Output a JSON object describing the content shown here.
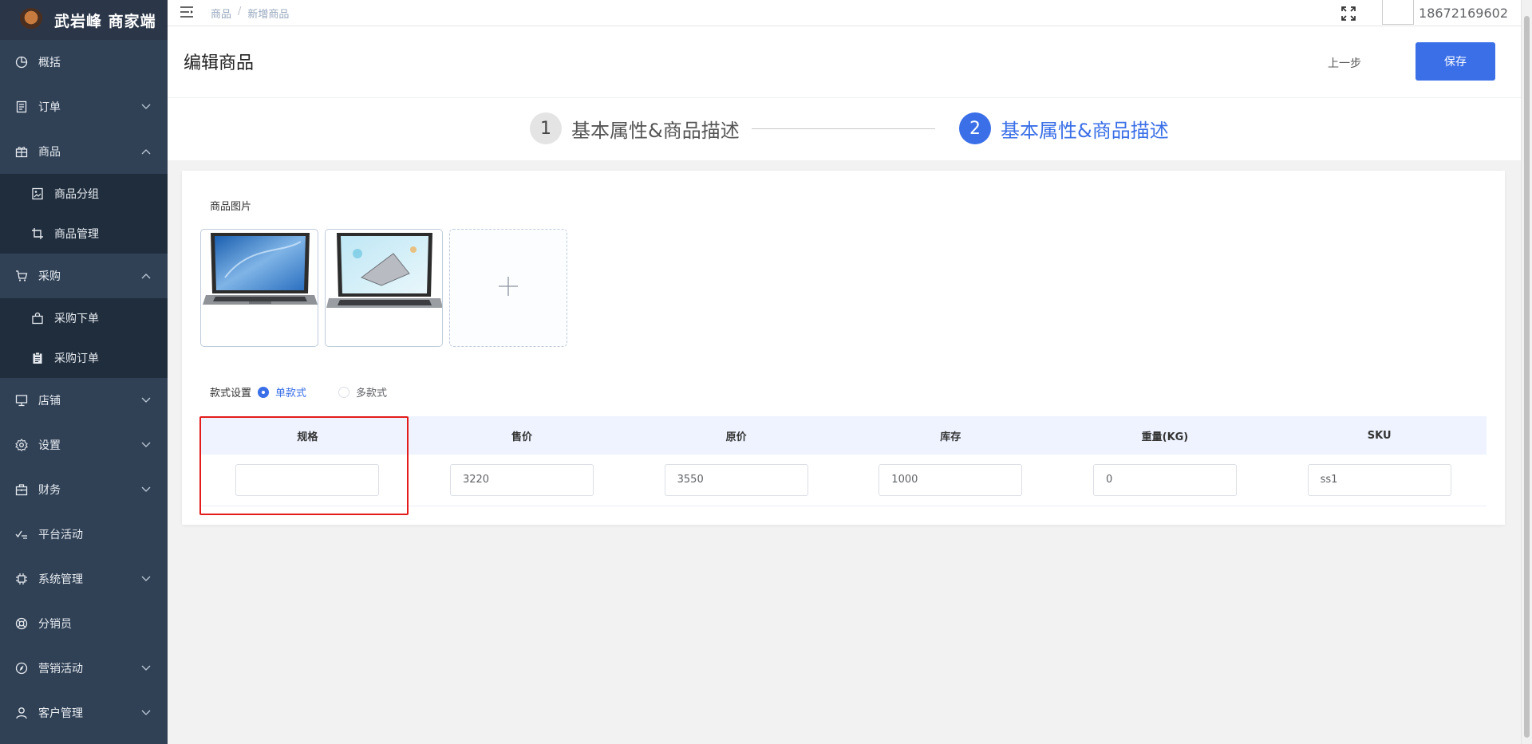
{
  "brand": {
    "title": "武岩峰 商家端"
  },
  "sidebar": {
    "items": [
      {
        "label": "概括",
        "icon": "pie-chart-icon",
        "expandable": false
      },
      {
        "label": "订单",
        "icon": "order-icon",
        "expandable": true,
        "expanded": false
      },
      {
        "label": "商品",
        "icon": "goods-icon",
        "expandable": true,
        "expanded": true,
        "children": [
          {
            "label": "商品分组",
            "icon": "image-group-icon"
          },
          {
            "label": "商品管理",
            "icon": "crop-icon"
          }
        ]
      },
      {
        "label": "采购",
        "icon": "cart-icon",
        "expandable": true,
        "expanded": true,
        "children": [
          {
            "label": "采购下单",
            "icon": "bag-icon"
          },
          {
            "label": "采购订单",
            "icon": "clipboard-icon"
          }
        ]
      },
      {
        "label": "店铺",
        "icon": "shop-icon",
        "expandable": true,
        "expanded": false
      },
      {
        "label": "设置",
        "icon": "gear-icon",
        "expandable": true,
        "expanded": false
      },
      {
        "label": "财务",
        "icon": "wallet-icon",
        "expandable": true,
        "expanded": false
      },
      {
        "label": "平台活动",
        "icon": "check-list-icon",
        "expandable": false
      },
      {
        "label": "系统管理",
        "icon": "chip-icon",
        "expandable": true,
        "expanded": false
      },
      {
        "label": "分销员",
        "icon": "lifebuoy-icon",
        "expandable": false
      },
      {
        "label": "营销活动",
        "icon": "compass-icon",
        "expandable": true,
        "expanded": false
      },
      {
        "label": "客户管理",
        "icon": "user-icon",
        "expandable": true,
        "expanded": false
      }
    ]
  },
  "topbar": {
    "breadcrumb": [
      "商品",
      "新增商品"
    ],
    "separator": "/",
    "username": "18672169602"
  },
  "header": {
    "title": "编辑商品",
    "prev_label": "上一步",
    "save_label": "保存"
  },
  "steps": [
    {
      "num": "1",
      "label": "基本属性&商品描述",
      "active": false
    },
    {
      "num": "2",
      "label": "基本属性&商品描述",
      "active": true
    }
  ],
  "form": {
    "images_label": "商品图片",
    "upload_plus": "+",
    "style_label": "款式设置",
    "style_options": [
      {
        "label": "单款式",
        "checked": true
      },
      {
        "label": "多款式",
        "checked": false
      }
    ],
    "table": {
      "headers": [
        "规格",
        "售价",
        "原价",
        "库存",
        "重量(KG)",
        "SKU"
      ],
      "row": [
        "",
        "3220",
        "3550",
        "1000",
        "0",
        "ss1"
      ]
    }
  },
  "colors": {
    "primary": "#3a6fe8",
    "sidebar": "#304156",
    "submenu": "#1f2d3d",
    "highlight": "#e31b1b"
  }
}
